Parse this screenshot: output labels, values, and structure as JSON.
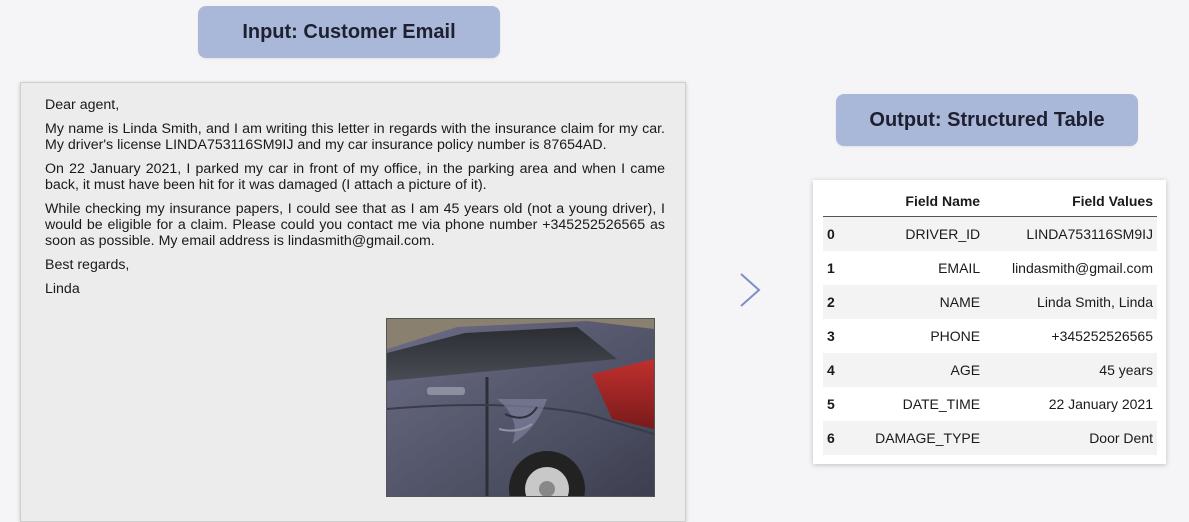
{
  "input_title": "Input: Customer Email",
  "output_title": "Output: Structured Table",
  "email": {
    "greeting": "Dear agent,",
    "paragraphs": [
      "My name is Linda Smith, and I am writing this letter in regards with the insurance claim for my car. My driver's license LINDA753116SM9IJ and my car insurance policy number is 87654AD.",
      "On 22 January 2021, I parked my car in front of my office, in the parking area and when I came back, it must have been hit for it was damaged (I attach a picture of it).",
      "While checking my insurance papers, I could see that as I am 45 years old (not a young driver), I would be eligible for a claim. Please could you contact me via phone number +345252526565 as soon as possible. My email address is lindasmith@gmail.com."
    ],
    "closing": "Best regards,",
    "signature": "Linda"
  },
  "table": {
    "headers": [
      "",
      "Field Name",
      "Field Values"
    ],
    "rows": [
      {
        "index": "0",
        "name": "DRIVER_ID",
        "value": "LINDA753116SM9IJ"
      },
      {
        "index": "1",
        "name": "EMAIL",
        "value": "lindasmith@gmail.com"
      },
      {
        "index": "2",
        "name": "NAME",
        "value": "Linda Smith, Linda"
      },
      {
        "index": "3",
        "name": "PHONE",
        "value": "+345252526565"
      },
      {
        "index": "4",
        "name": "AGE",
        "value": "45 years"
      },
      {
        "index": "5",
        "name": "DATE_TIME",
        "value": "22 January 2021"
      },
      {
        "index": "6",
        "name": "DAMAGE_TYPE",
        "value": "Door Dent"
      }
    ]
  },
  "colors": {
    "pill": "#a9b8d8",
    "arrow": "#7d8fc4"
  }
}
